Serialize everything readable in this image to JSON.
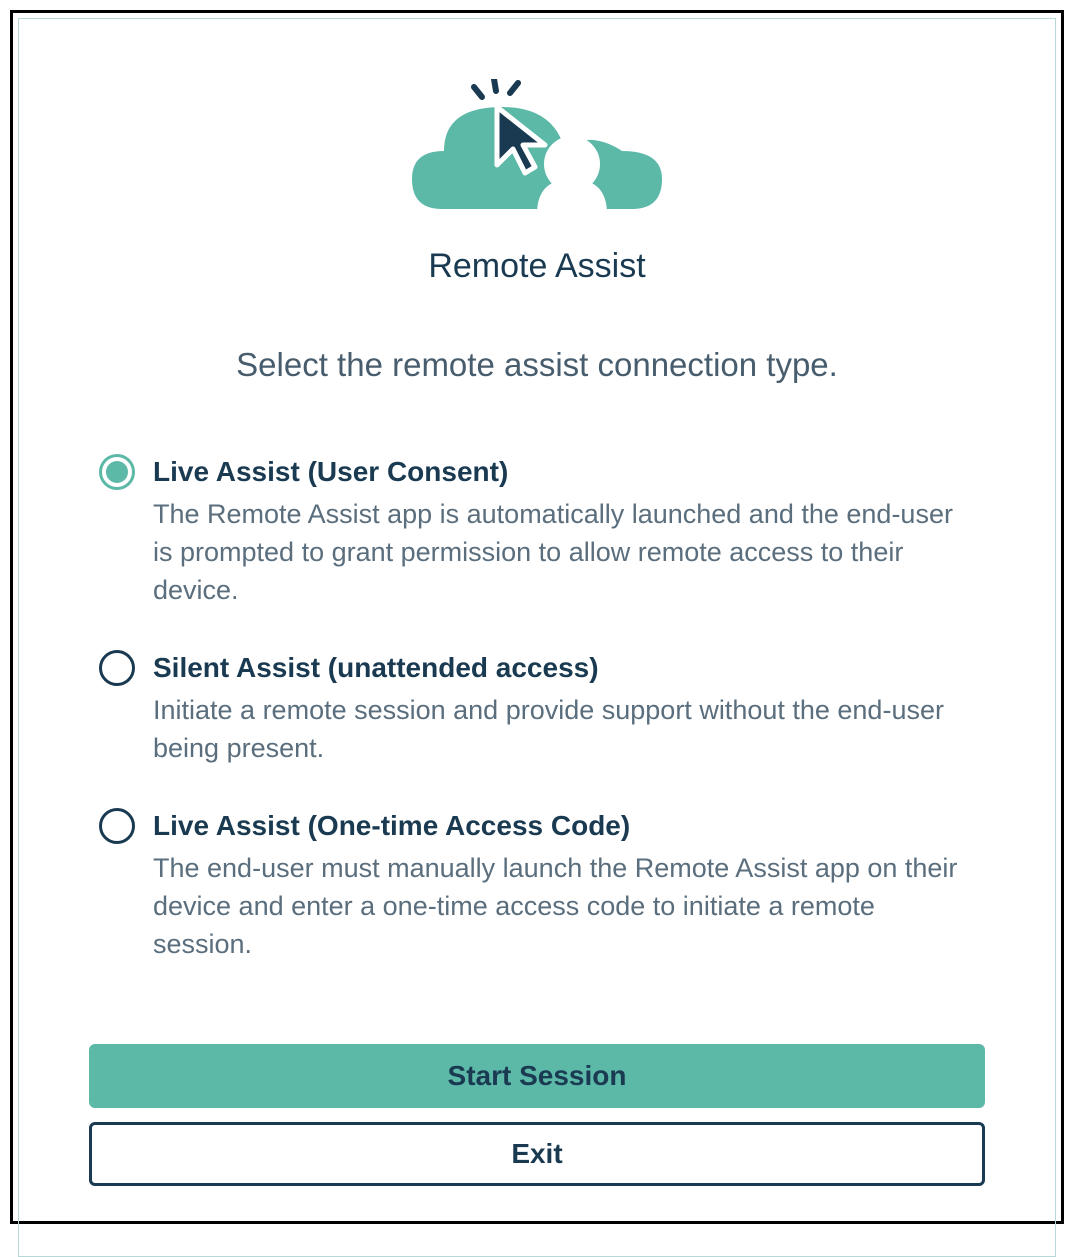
{
  "brand": "Remote Assist",
  "subtitle": "Select the remote assist connection type.",
  "options": [
    {
      "title": "Live Assist (User Consent)",
      "desc": "The Remote Assist app is automatically launched and the end-user is prompted to grant permission to allow remote access to their device.",
      "selected": true
    },
    {
      "title": "Silent Assist (unattended access)",
      "desc": "Initiate a remote session and provide support without the end-user being present.",
      "selected": false
    },
    {
      "title": "Live Assist (One-time Access Code)",
      "desc": "The end-user must manually launch the Remote Assist app on their device and enter a one-time access code to initiate a remote session.",
      "selected": false
    }
  ],
  "buttons": {
    "primary": "Start Session",
    "secondary": "Exit"
  },
  "colors": {
    "accent": "#5cb8a7",
    "dark": "#1a3a52"
  }
}
